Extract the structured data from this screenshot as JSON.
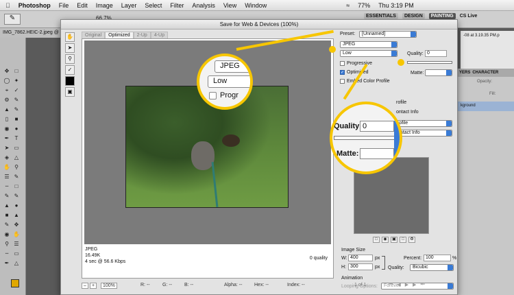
{
  "menubar": {
    "app": "Photoshop",
    "items": [
      "File",
      "Edit",
      "Image",
      "Layer",
      "Select",
      "Filter",
      "Analysis",
      "View",
      "Window"
    ],
    "clock": "Thu 3:19 PM",
    "battery": "77%"
  },
  "optionsbar": {
    "zoom": "66.7%"
  },
  "workspaces": {
    "items": [
      "ESSENTIALS",
      "DESIGN",
      "PAINTING"
    ],
    "cslive": "CS Live"
  },
  "document": {
    "tab": "IMG_7862.HEIC-2.jpeg @ 66.7%",
    "right_tab": "-08 at 3.19.35 PM.p"
  },
  "rightpanel": {
    "tabs": [
      "YERS",
      "CHARACTER"
    ],
    "opacity_label": "Opacity:",
    "fill_label": "Fill:",
    "layer": "kground"
  },
  "dialog": {
    "title": "Save for Web & Devices (100%)",
    "tabs": [
      "Original",
      "Optimized",
      "2-Up",
      "4-Up"
    ],
    "preview": {
      "format": "JPEG",
      "size": "16.49K",
      "time": "4 sec @ 56.6 Kbps",
      "quality": "0 quality"
    },
    "status": {
      "zoom": "100%",
      "r": "R: --",
      "g": "G: --",
      "b": "B: --",
      "alpha": "Alpha: --",
      "hex": "Hex: --",
      "index": "Index: --"
    },
    "settings": {
      "preset_label": "Preset:",
      "preset_value": "[Unnamed]",
      "format": "JPEG",
      "compression": "Low",
      "quality_label": "Quality:",
      "quality_value": "0",
      "progressive": "Progressive",
      "optimized": "Optimized",
      "embed": "Embed Color Profile",
      "matte_label": "Matte:",
      "profile_text": "rofile",
      "metadata_text": "ontact Info",
      "image_size_label": "Image Size",
      "w_label": "W:",
      "w_value": "400",
      "h_label": "H:",
      "h_value": "300",
      "px": "px",
      "percent_label": "Percent:",
      "percent_value": "100",
      "percent_unit": "%",
      "resample_label": "Quality:",
      "resample_value": "Bicubic",
      "animation_label": "Animation",
      "looping_label": "Looping Options:",
      "looping_value": "Forever",
      "frame": "1 of 1"
    }
  },
  "callouts": {
    "left": {
      "format": "JPEG",
      "compression": "Low",
      "progressive": "Progr"
    },
    "right": {
      "quality_label": "Quality:",
      "quality_value": "0",
      "matte_label": "Matte:",
      "profile_text": "rofile",
      "metadata_text": "ontact Info"
    }
  },
  "colors": {
    "accent": "#f7c600",
    "selected": "#3a7bd5"
  }
}
